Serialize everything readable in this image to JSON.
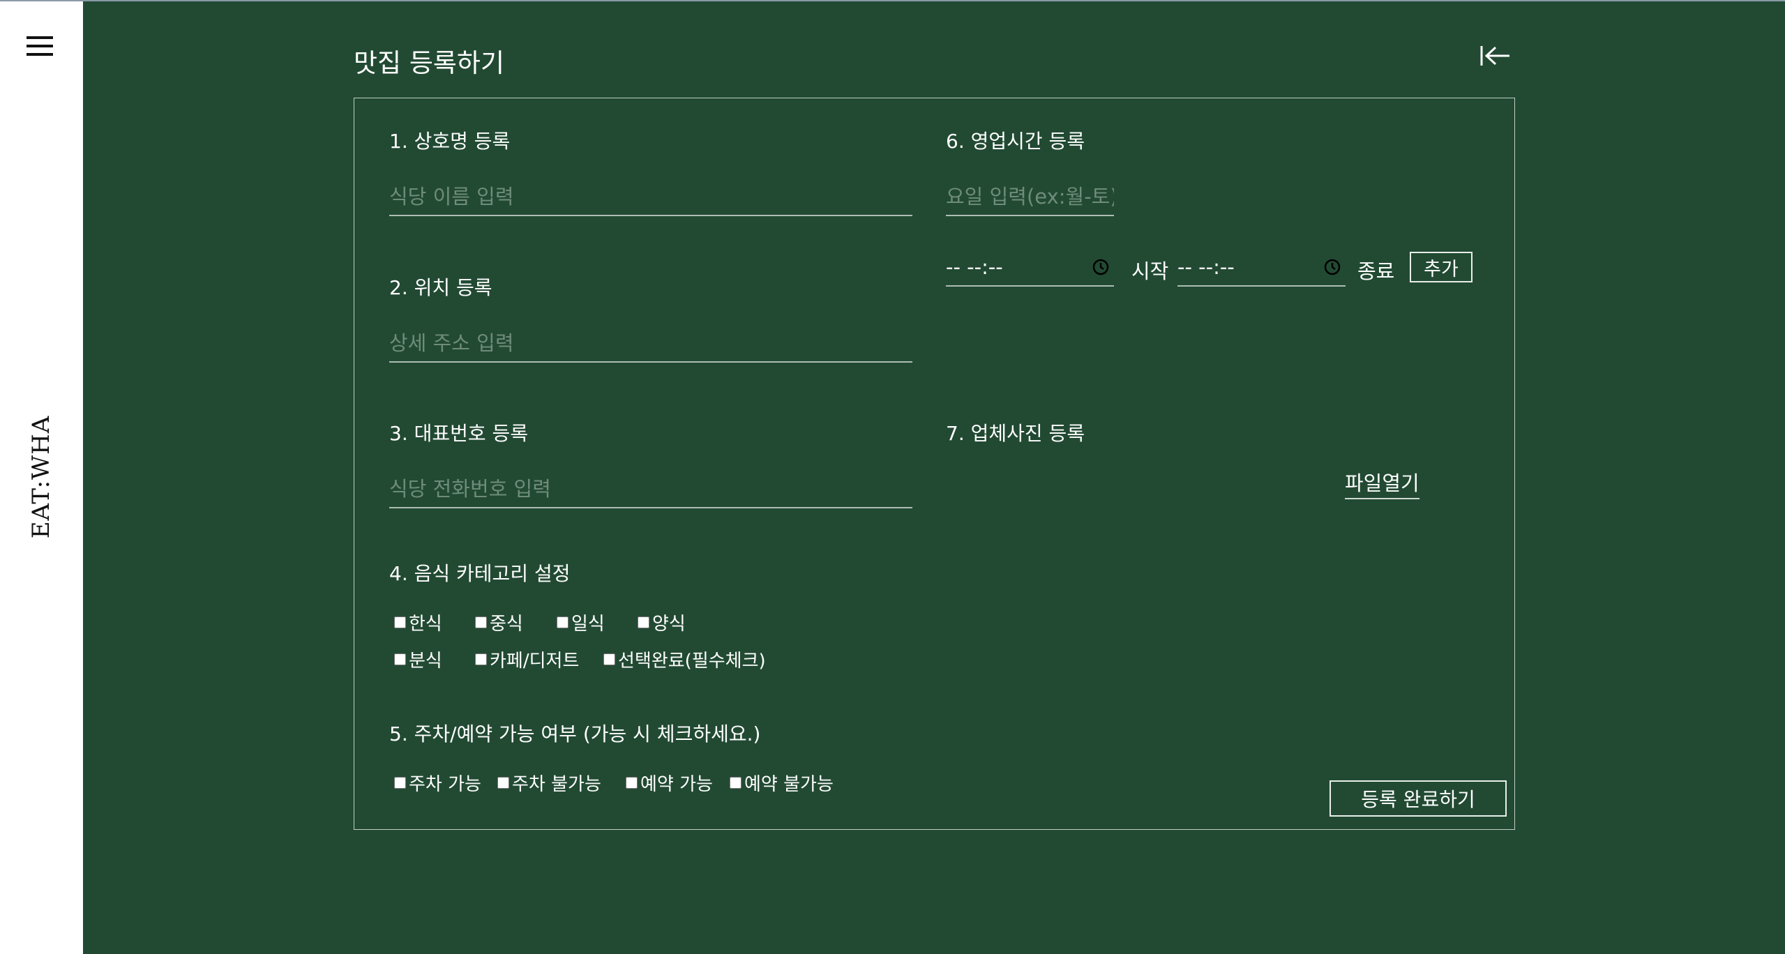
{
  "sidebar": {
    "menu_icon": "hamburger-menu-icon",
    "logo": "EAT:WHA"
  },
  "header": {
    "title": "맛집 등록하기",
    "back_icon": "collapse-left-arrow-icon"
  },
  "form": {
    "section1": {
      "label": "1. 상호명 등록",
      "placeholder": "식당 이름 입력"
    },
    "section2": {
      "label": "2. 위치 등록",
      "placeholder": "상세 주소 입력"
    },
    "section3": {
      "label": "3. 대표번호 등록",
      "placeholder": "식당 전화번호 입력"
    },
    "section4": {
      "label": "4. 음식 카테고리 설정",
      "options": [
        "한식",
        "중식",
        "일식",
        "양식",
        "분식",
        "카페/디저트",
        "선택완료(필수체크)"
      ]
    },
    "section5": {
      "label": "5. 주차/예약 가능 여부 (가능 시 체크하세요.)",
      "options": [
        "주차 가능",
        "주차 불가능",
        "예약 가능",
        "예약 불가능"
      ]
    },
    "section6": {
      "label": "6. 영업시간 등록",
      "day_placeholder": "요일 입력(ex:월-토)",
      "start_time": "-- --:--",
      "start_label": "시작",
      "end_time": "-- --:--",
      "end_label": "종료",
      "add_button": "추가",
      "clock_icon": "clock-icon"
    },
    "section7": {
      "label": "7. 업체사진 등록",
      "file_button": "파일열기"
    },
    "submit_button": "등록 완료하기"
  },
  "colors": {
    "background": "#224a33",
    "sidebar": "#ffffff",
    "text": "#ffffff",
    "placeholder": "#6f8c7a",
    "border": "#bfcfc4"
  }
}
